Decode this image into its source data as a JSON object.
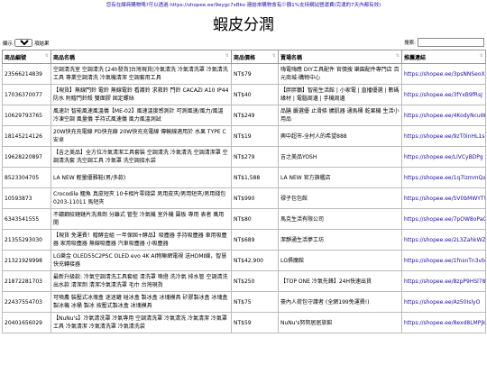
{
  "banner": "您有在線商購物嗎?可以透過 https://shopee.ee/9eygc7xBko 連結來購物會有少額1%支持網站營運費(完運的7天內都有效)",
  "page_title": "蝦皮分潤",
  "controls": {
    "show_label": "顯示",
    "entries_value": "10",
    "entries_suffix": "項結果",
    "search_label": "搜索:"
  },
  "columns": [
    "商品編號",
    "商品名稱",
    "商品價格",
    "賣場名稱",
    "推薦連結"
  ],
  "rows": [
    {
      "id": "23566214839",
      "name": "空調清洗室 空調清洗 [24h發貨]台灣現貨|冷氣清洗 冷氣清洗罩 冷氣清洗 工具 專業空調清洗 冷氣機清潔 空調套用工具",
      "price": "NT$79",
      "shop": "嗨電嗨應 DIY工具配件 官價搜 樂園配件專門店 百元商城-購物中心",
      "link": "https://shopee.ee/3psNNSeoXK"
    },
    {
      "id": "17036370077",
      "name": "【現貨】無線門鈴 電鈴 無線電鈴 看護鈴 求救鈴 門鈴 CACAZI A10 IP44防水 附贈門鈴殼 雙面膠 固定螺絲",
      "price": "NT$40",
      "shop": "【胖胖鵝】智能生活館 | 小家電 | 直播優選 | 數碼緣材 | 電腦周邊 | 手機周邊",
      "link": "https://shopee.ee/3fYxB9fRsJ"
    },
    {
      "id": "10629793765",
      "name": "風速計 智能風速風溫儀【ME-02】風速溫度感測計 可測風速/風力/風溫 冷凍空調 風量儀 手持式風速儀 風力風溫測試",
      "price": "NT$249",
      "shop": "品膳 嚴選優 止滑條 擴肌器 通馬桶 乾果機 生活小用品",
      "link": "https://shopee.ee/4KodyNcuWN"
    },
    {
      "id": "18145214126",
      "name": "20W快充充電線 PD快充線 20W快充充電線 傳輸線適用於 水果 TYPE C 安卓",
      "price": "NT$19",
      "shop": "興中超市-全村人的希望888",
      "link": "https://shopee.ee/9zT0inHL1s"
    },
    {
      "id": "19628220897",
      "name": "【吉之美品】全方位冷氣清潔工具套裝 空調清洗 冷氣清洗 空調清潔罩 空調清洗套 洗空調工具 冷氣罩 洗空調接水袋",
      "price": "NT$279",
      "shop": "吉之美品YOSH",
      "link": "https://shopee.ee/LIVCyBDPg"
    },
    {
      "id": "8523304705",
      "name": "LA NEW 輕量優雅鞋(男/多款)",
      "price": "NT$1,588",
      "shop": "LA NEW 官方旗艦店",
      "link": "https://shopee.ee/1q7lzmmQac"
    },
    {
      "id": "10593873",
      "name": "Crocodile 鱷魚 真皮短夾 10卡相片零錢袋 男用皮夾/男用短夾/男用錢包 0203-11011 馬短夾",
      "price": "NT$990",
      "shop": "禄子包包館",
      "link": "https://shopee.ee/5V0bMWYT9x"
    },
    {
      "id": "6343541555",
      "name": "不鏽鋼絞鏈鏈片洗滌劑 分離式 管型 冷氣機 室外機 圍板 專用 表者 萬用開",
      "price": "NT$80",
      "shop": "馬克生活有限公司",
      "link": "https://shopee.ee/7pOW8oPaQF"
    },
    {
      "id": "21355293030",
      "name": "【現貨 免運費！贈酵金組 一年保固+酵品】吸塵器 手持吸塵器 車用吸塵器 家用吸塵器 無線吸塵器 汽車吸塵器 小吸塵器",
      "price": "NT$689",
      "shop": "潔靜通生活夢工坊",
      "link": "https://shopee.ee/2L3ZahkWZf"
    },
    {
      "id": "21321929998",
      "name": "LG樂金 OLED55C2PSC OLED evo 4K AI物聯網電視 送HDMI線，智慧快充轉接器",
      "price": "NT$42,900",
      "shop": "LG俱魔館",
      "link": "https://shopee.ee/1fnsnTn3vb"
    },
    {
      "id": "21872281703",
      "name": "最新升級款: 冷氣空調清洗工具套組 清洗罩 噴燈 洗冷氣 排水管 空調清洗 出水款 清潔劑 清潔冷氣清洗罩 毛巾 台灣現貨",
      "price": "NT$250",
      "shop": "【TOP ONE 冷氣先鋒】24H快速出貨",
      "link": "https://shopee.ee/8zpP9HSl78"
    },
    {
      "id": "22437554703",
      "name": "可噴農 裝壓式冰塊盒 迷迷罐 碰冰盒 製冰盒 冰塊模具 矽膠製冰盒 冰塊盒 製冰機 冰桶 製冰 按壓式製冰盒 冰塊模具",
      "price": "NT$75",
      "shop": "豪內人荷包守護者 (全網199免運費!)",
      "link": "https://shopee.ee/Az50IslyO"
    },
    {
      "id": "20401656029",
      "name": "【NuNu's】冷氣清洗罩 冷氣專用 空調清洗罩 冷氣清洗 冷氣清潔 冷氣罩工具 冷氣清潔 冷氣清洗罩 冷氣清洗袋",
      "price": "NT$59",
      "shop": "NuNu's努努居居旅館",
      "link": "https://shopee.ee/8exd8LMPjk"
    }
  ]
}
